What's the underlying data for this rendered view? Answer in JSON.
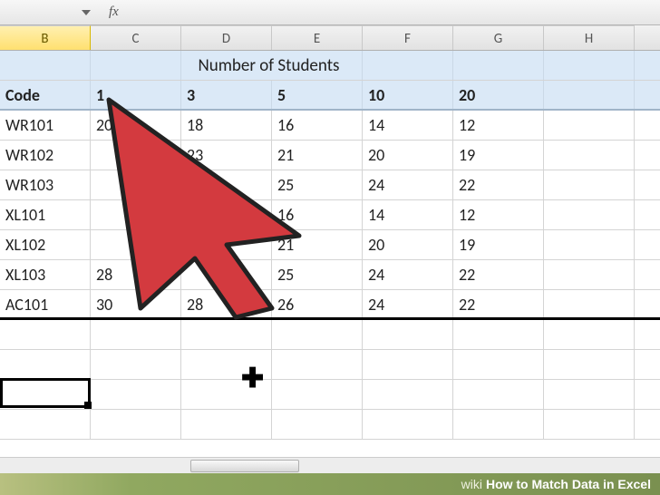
{
  "formula_bar": {
    "fx": "fx"
  },
  "columns": [
    "B",
    "C",
    "D",
    "E",
    "F",
    "G",
    "H"
  ],
  "selected_column": "B",
  "title": "Number of Students",
  "headers": [
    "Code",
    "1",
    "3",
    "5",
    "10",
    "20"
  ],
  "rows": [
    {
      "code": "WR101",
      "v": [
        "20",
        "18",
        "16",
        "14",
        "12"
      ]
    },
    {
      "code": "WR102",
      "v": [
        "",
        "23",
        "21",
        "20",
        "19"
      ]
    },
    {
      "code": "WR103",
      "v": [
        "",
        "",
        "25",
        "24",
        "22"
      ]
    },
    {
      "code": "XL101",
      "v": [
        "",
        "",
        "16",
        "14",
        "12"
      ]
    },
    {
      "code": "XL102",
      "v": [
        "",
        "",
        "21",
        "20",
        "19"
      ]
    },
    {
      "code": "XL103",
      "v": [
        "28",
        "",
        "25",
        "24",
        "22"
      ]
    },
    {
      "code": "AC101",
      "v": [
        "30",
        "28",
        "26",
        "24",
        "22"
      ]
    }
  ],
  "footer": {
    "wiki": "wiki",
    "title": "How to Match Data in Excel"
  }
}
